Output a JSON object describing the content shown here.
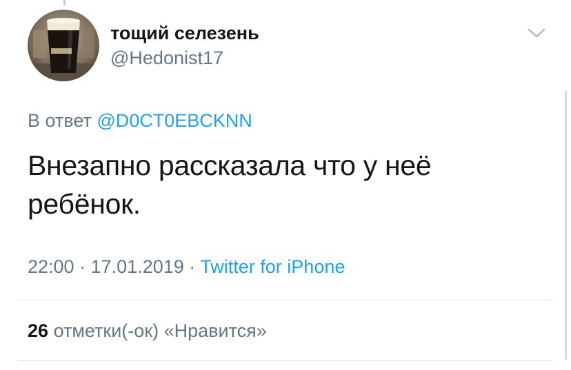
{
  "author": {
    "display_name": "тощий селезень",
    "handle": "@Hedonist17",
    "avatar_icon": "beer-glass-avatar"
  },
  "reply": {
    "label": "В ответ",
    "handle": "@D0CT0EBCKNN"
  },
  "tweet": {
    "text": "Внезапно рассказала что у неё ребёнок."
  },
  "meta": {
    "time": "22:00",
    "separator": "·",
    "date": "17.01.2019",
    "source": "Twitter for iPhone"
  },
  "stats": {
    "likes_count": "26",
    "likes_label": "отметки(-ок) «Нравится»"
  },
  "colors": {
    "text": "#14171a",
    "secondary": "#657786",
    "link": "#1da1f2",
    "divider": "#e1e8ed"
  }
}
